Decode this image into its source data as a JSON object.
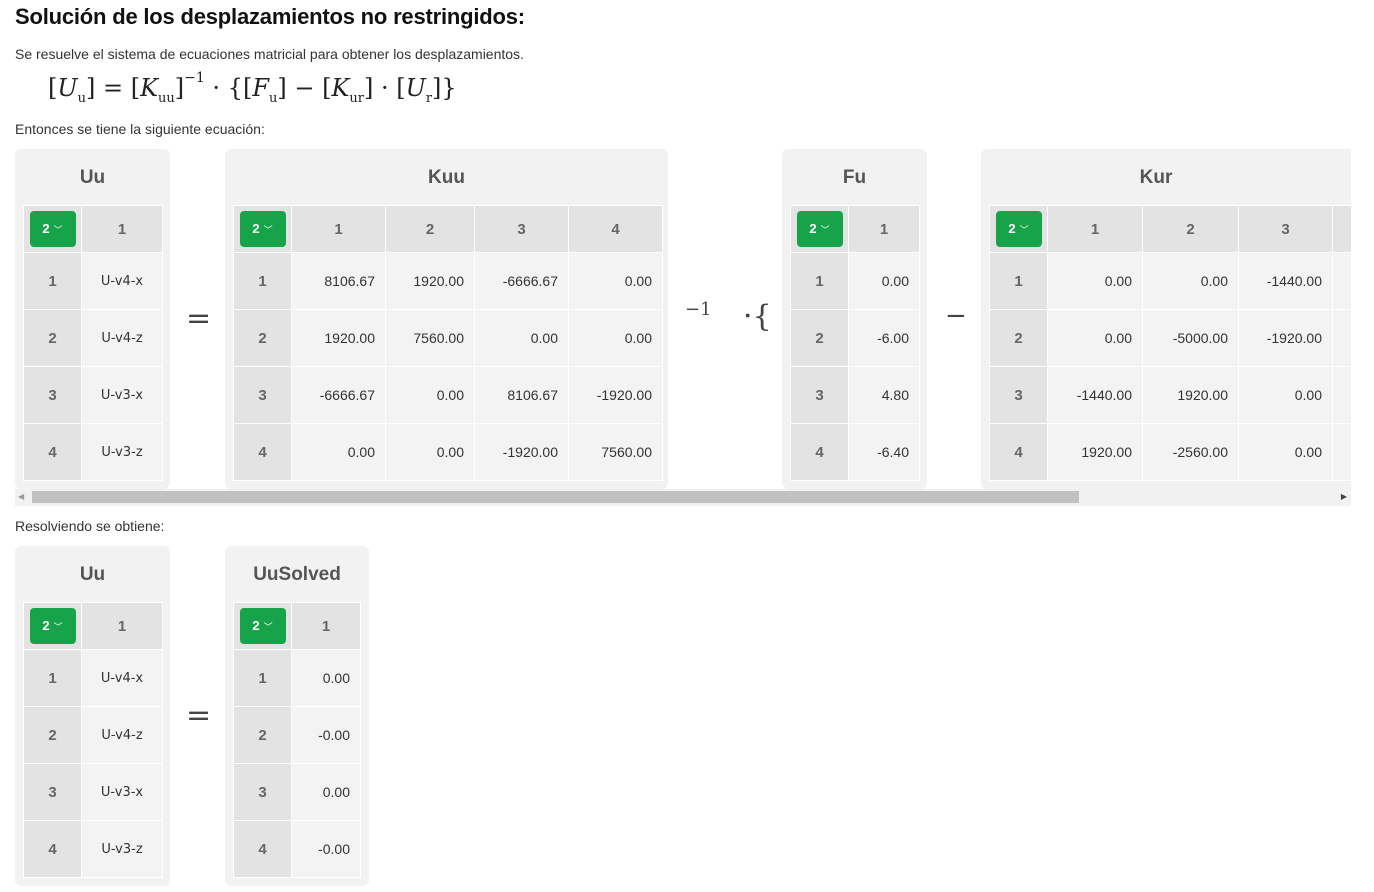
{
  "heading": "Solución de los desplazamientos no restringidos:",
  "description": "Se resuelve el sistema de ecuaciones matricial para obtener los desplazamientos.",
  "formula": {
    "lhs": "U",
    "lhs_sub": "u",
    "k": "K",
    "k_sub": "uu",
    "inv": "−1",
    "f": "F",
    "f_sub": "u",
    "kr": "K",
    "kr_sub": "ur",
    "ur": "U",
    "ur_sub": "r"
  },
  "then_text": "Entonces se tiene la siguiente ecuación:",
  "result_text": "Resolviendo se obtiene:",
  "dim_value": "2",
  "operators": {
    "equals": "=",
    "inverse": "−1",
    "dot_brace": "·{",
    "minus": "−"
  },
  "uu": {
    "title": "Uu",
    "col_headers": [
      "1"
    ],
    "row_headers": [
      "1",
      "2",
      "3",
      "4"
    ],
    "rows": [
      [
        "U-v4-x"
      ],
      [
        "U-v4-z"
      ],
      [
        "U-v3-x"
      ],
      [
        "U-v3-z"
      ]
    ]
  },
  "kuu": {
    "title": "Kuu",
    "col_headers": [
      "1",
      "2",
      "3",
      "4"
    ],
    "row_headers": [
      "1",
      "2",
      "3",
      "4"
    ],
    "rows": [
      [
        "8106.67",
        "1920.00",
        "-6666.67",
        "0.00"
      ],
      [
        "1920.00",
        "7560.00",
        "0.00",
        "0.00"
      ],
      [
        "-6666.67",
        "0.00",
        "8106.67",
        "-1920.00"
      ],
      [
        "0.00",
        "0.00",
        "-1920.00",
        "7560.00"
      ]
    ]
  },
  "fu": {
    "title": "Fu",
    "col_headers": [
      "1"
    ],
    "row_headers": [
      "1",
      "2",
      "3",
      "4"
    ],
    "rows": [
      [
        "0.00"
      ],
      [
        "-6.00"
      ],
      [
        "4.80"
      ],
      [
        "-6.40"
      ]
    ]
  },
  "kur": {
    "title": "Kur",
    "col_headers": [
      "1",
      "2",
      "3"
    ],
    "row_headers": [
      "1",
      "2",
      "3",
      "4"
    ],
    "rows": [
      [
        "0.00",
        "0.00",
        "-1440.00"
      ],
      [
        "0.00",
        "-5000.00",
        "-1920.00"
      ],
      [
        "-1440.00",
        "1920.00",
        "0.00"
      ],
      [
        "1920.00",
        "-2560.00",
        "0.00"
      ]
    ]
  },
  "uu2": {
    "title": "Uu",
    "col_headers": [
      "1"
    ],
    "row_headers": [
      "1",
      "2",
      "3",
      "4"
    ],
    "rows": [
      [
        "U-v4-x"
      ],
      [
        "U-v4-z"
      ],
      [
        "U-v3-x"
      ],
      [
        "U-v3-z"
      ]
    ]
  },
  "uusolved": {
    "title": "UuSolved",
    "col_headers": [
      "1"
    ],
    "row_headers": [
      "1",
      "2",
      "3",
      "4"
    ],
    "rows": [
      [
        "0.00"
      ],
      [
        "-0.00"
      ],
      [
        "0.00"
      ],
      [
        "-0.00"
      ]
    ]
  }
}
